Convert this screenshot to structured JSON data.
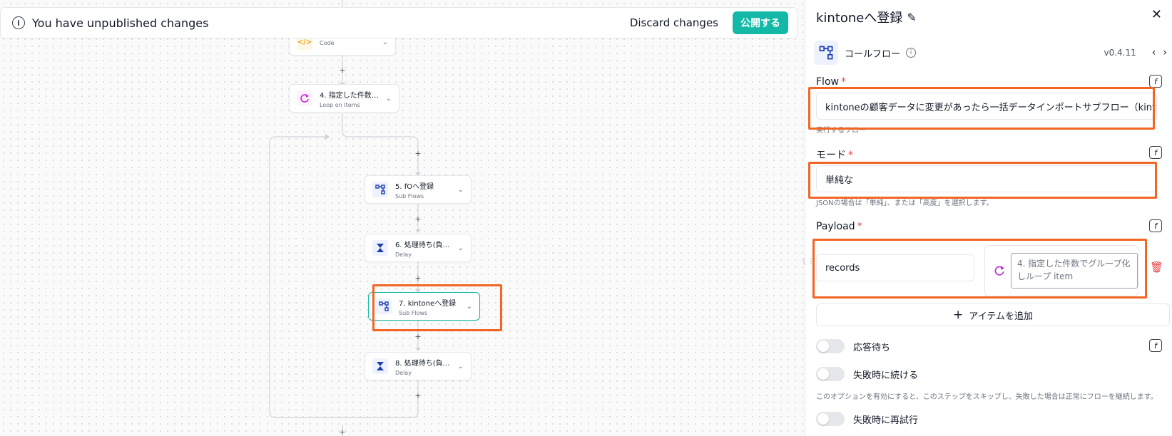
{
  "banner": {
    "message": "You have unpublished changes",
    "discard_label": "Discard changes",
    "publish_label": "公開する"
  },
  "nodes": [
    {
      "title": "",
      "subtitle": "Code",
      "icon": "code-icon"
    },
    {
      "title": "4. 指定した件数で...",
      "subtitle": "Loop on Items",
      "icon": "loop-icon"
    },
    {
      "title": "5. fOへ登録",
      "subtitle": "Sub Flows",
      "icon": "subflow-icon"
    },
    {
      "title": "6. 処理待ち(負荷...",
      "subtitle": "Delay",
      "icon": "hourglass-icon"
    },
    {
      "title": "7. kintoneへ登録",
      "subtitle": "Sub Flows",
      "icon": "subflow-icon"
    },
    {
      "title": "8. 処理待ち(負荷...",
      "subtitle": "Delay",
      "icon": "hourglass-icon"
    }
  ],
  "panel": {
    "title": "kintoneへ登録",
    "app_name": "コールフロー",
    "version": "v0.4.11",
    "flow": {
      "label": "Flow",
      "value": "kintoneの顧客データに変更があったら一括データインポートサブフロー（kintone登",
      "hint": "実行するフロー"
    },
    "mode": {
      "label": "モード",
      "value": "単純な",
      "hint": "JSONの場合は「単純」、または「高度」を選択します。"
    },
    "payload": {
      "label": "Payload",
      "key": "records",
      "value": "4. 指定した件数でグループ化しループ item"
    },
    "add_item_label": "アイテムを追加",
    "toggles": [
      {
        "label": "応答待ち",
        "hint": ""
      },
      {
        "label": "失敗時に続ける",
        "hint": "このオプションを有効にすると、このステップをスキップし、失敗した場合は正常にフローを継続します。"
      },
      {
        "label": "失敗時に再試行",
        "hint": ""
      }
    ]
  },
  "colors": {
    "accent": "#14b8a6",
    "highlight": "#f26522",
    "required": "#ef4444"
  }
}
